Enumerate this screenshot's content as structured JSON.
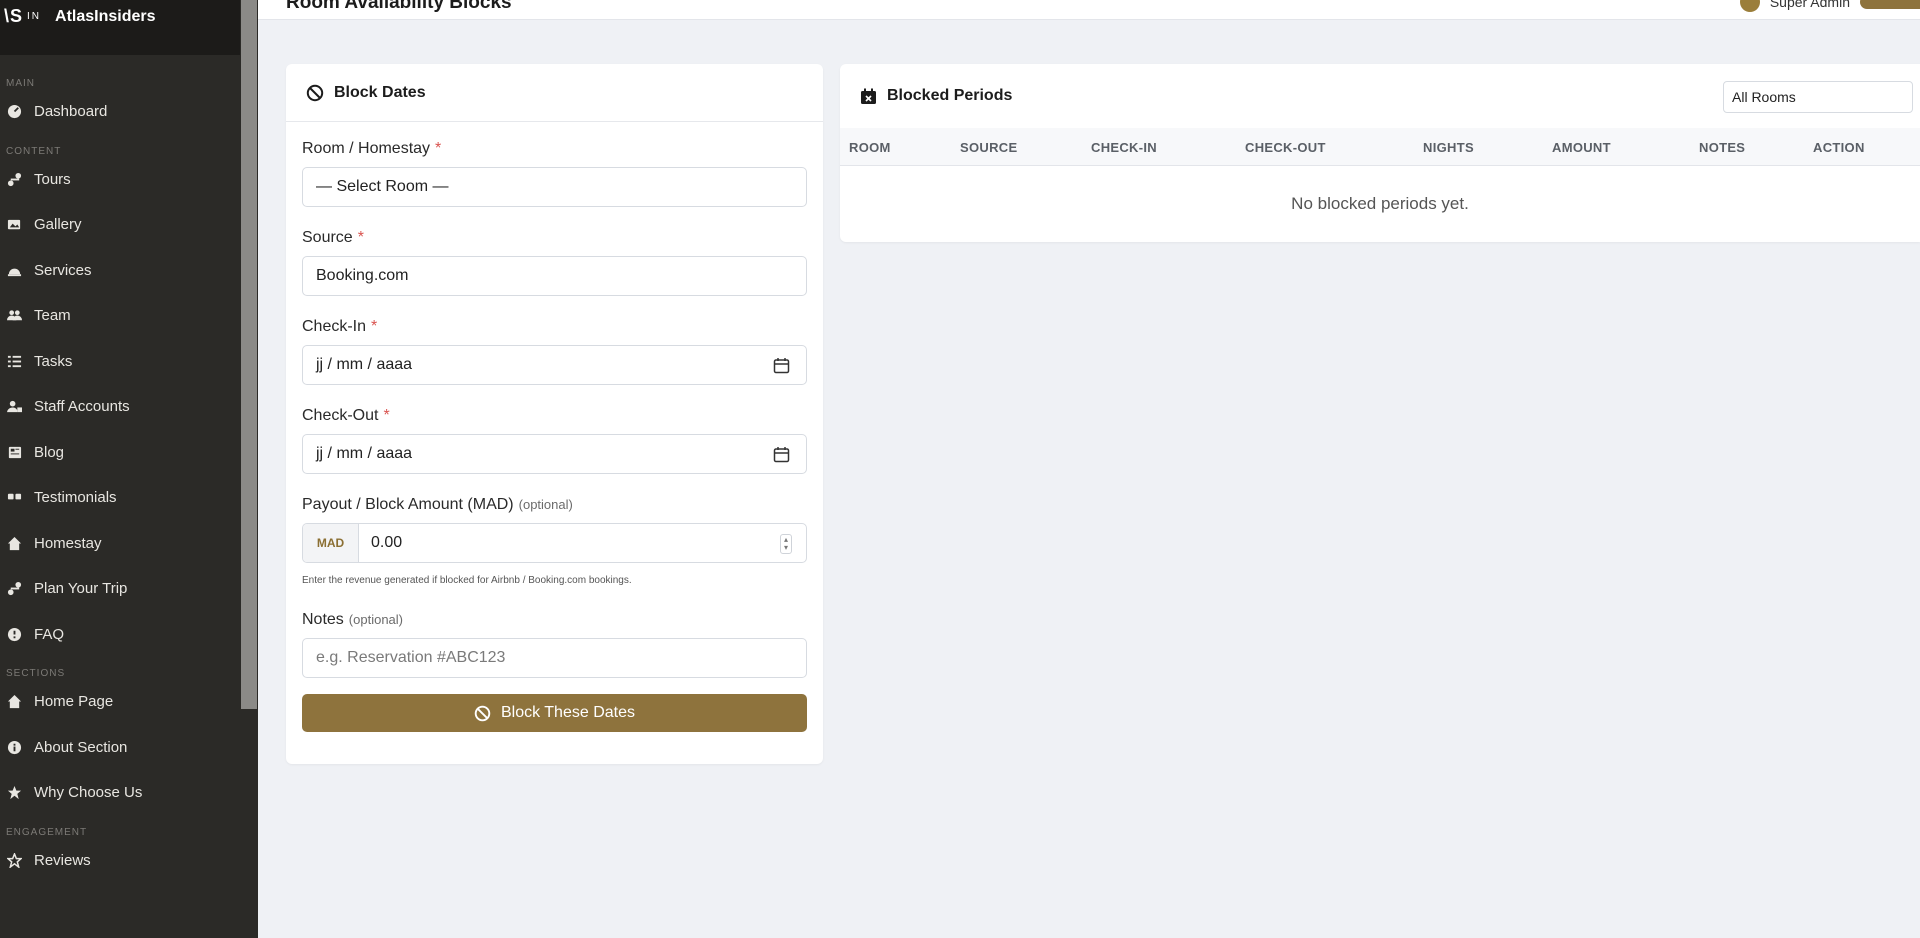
{
  "brand": {
    "logo": "\\S",
    "logo_small": "IN",
    "name": "AtlasInsiders"
  },
  "sidebar": {
    "sections": [
      {
        "label": "MAIN",
        "items": [
          {
            "label": "Dashboard",
            "icon": "dashboard-icon"
          }
        ]
      },
      {
        "label": "CONTENT",
        "items": [
          {
            "label": "Tours",
            "icon": "route-icon"
          },
          {
            "label": "Gallery",
            "icon": "images-icon"
          },
          {
            "label": "Services",
            "icon": "bell-concierge-icon"
          },
          {
            "label": "Team",
            "icon": "users-icon"
          },
          {
            "label": "Tasks",
            "icon": "list-check-icon"
          },
          {
            "label": "Staff Accounts",
            "icon": "user-lock-icon"
          },
          {
            "label": "Blog",
            "icon": "newspaper-icon"
          },
          {
            "label": "Testimonials",
            "icon": "quote-icon"
          },
          {
            "label": "Homestay",
            "icon": "home-icon"
          },
          {
            "label": "Plan Your Trip",
            "icon": "route-icon"
          },
          {
            "label": "FAQ",
            "icon": "question-icon"
          }
        ]
      },
      {
        "label": "SECTIONS",
        "items": [
          {
            "label": "Home Page",
            "icon": "home-icon"
          },
          {
            "label": "About Section",
            "icon": "info-icon"
          },
          {
            "label": "Why Choose Us",
            "icon": "star-icon"
          }
        ]
      },
      {
        "label": "ENGAGEMENT",
        "items": [
          {
            "label": "Reviews",
            "icon": "star-outline-icon"
          }
        ]
      }
    ]
  },
  "header": {
    "title": "Room Availability Blocks",
    "user_name": "Super Admin"
  },
  "block_form": {
    "title": "Block Dates",
    "room": {
      "label": "Room / Homestay",
      "value": "— Select Room —"
    },
    "source": {
      "label": "Source",
      "value": "Booking.com"
    },
    "check_in": {
      "label": "Check-In",
      "value": "jj / mm / aaaa"
    },
    "check_out": {
      "label": "Check-Out",
      "value": "jj / mm / aaaa"
    },
    "amount": {
      "label": "Payout / Block Amount (MAD)",
      "optional": "(optional)",
      "currency": "MAD",
      "value": "0.00",
      "hint": "Enter the revenue generated if blocked for Airbnb / Booking.com bookings."
    },
    "notes": {
      "label": "Notes",
      "optional": "(optional)",
      "placeholder": "e.g. Reservation #ABC123"
    },
    "submit_label": "Block These Dates"
  },
  "periods": {
    "title": "Blocked Periods",
    "filter_value": "All Rooms",
    "columns": [
      "ROOM",
      "SOURCE",
      "CHECK-IN",
      "CHECK-OUT",
      "NIGHTS",
      "AMOUNT",
      "NOTES",
      "ACTION"
    ],
    "empty_text": "No blocked periods yet."
  },
  "colors": {
    "accent": "#8e733d",
    "sidebar": "#2b2a27",
    "required": "#d9534f"
  }
}
